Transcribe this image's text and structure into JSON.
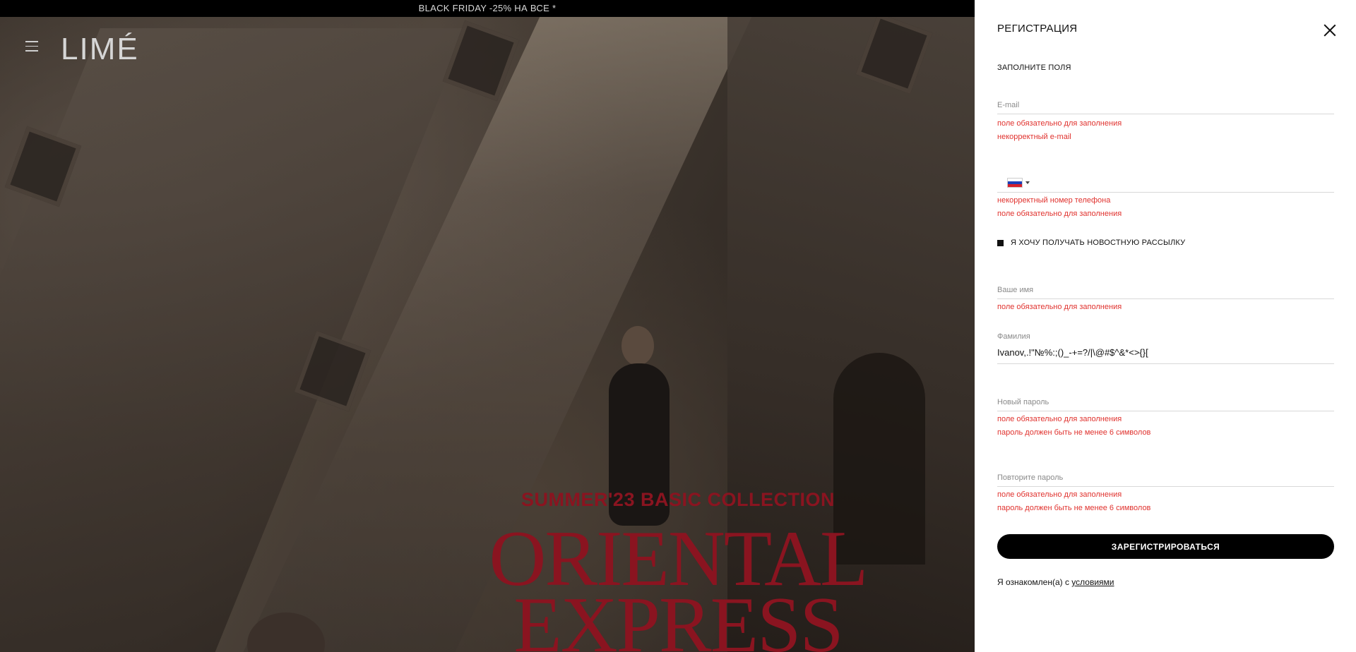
{
  "promo": {
    "text": "BLACK FRIDAY -25% НА ВСЕ *"
  },
  "header": {
    "logo": "LIMÉ"
  },
  "hero": {
    "subtitle": "SUMMER'23 BASIC COLLECTION",
    "title_line1": "ORIENTAL",
    "title_line2": "EXPRESS",
    "accent_color": "#8a1420"
  },
  "registration": {
    "title": "РЕГИСТРАЦИЯ",
    "subtitle": "ЗАПОЛНИТЕ ПОЛЯ",
    "email": {
      "label": "E-mail",
      "value": "",
      "errors": [
        "поле обязательно для заполнения",
        "некорректный e-mail"
      ]
    },
    "phone": {
      "country_flag": "russia-flag-icon",
      "value": "",
      "errors": [
        "некорректный номер телефона",
        "поле обязательно для заполнения"
      ]
    },
    "newsletter": {
      "label": "Я ХОЧУ ПОЛУЧАТЬ НОВОСТНУЮ РАССЫЛКУ",
      "checked": true
    },
    "first_name": {
      "label": "Ваше имя",
      "value": "",
      "errors": [
        "поле обязательно для заполнения"
      ]
    },
    "last_name": {
      "label": "Фамилия",
      "value": "Ivanov,.!\"№%:;()_-+=?/|\\@#$^&*<>{}[",
      "errors": []
    },
    "new_password": {
      "label": "Новый пароль",
      "value": "",
      "errors": [
        "поле обязательно для заполнения",
        "пароль должен быть не менее 6 символов"
      ]
    },
    "repeat_password": {
      "label": "Повторите пароль",
      "value": "",
      "errors": [
        "поле обязательно для заполнения",
        "пароль должен быть не менее 6 символов"
      ]
    },
    "submit_label": "ЗАРЕГИСТРИРОВАТЬСЯ",
    "terms_prefix": "Я ознакомлен(а) с ",
    "terms_link": "условиями",
    "error_color": "#e0322e"
  }
}
